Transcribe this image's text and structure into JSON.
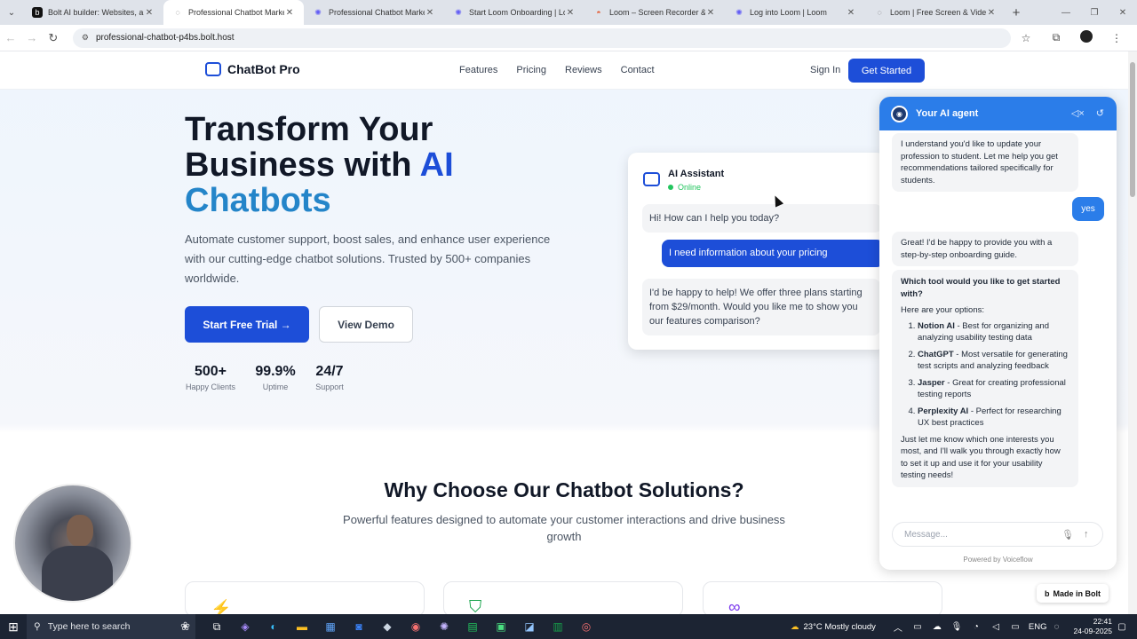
{
  "browser": {
    "tabs": [
      {
        "title": "Bolt AI builder: Websites, apps",
        "icon": "bolt-icon",
        "active": false
      },
      {
        "title": "Professional Chatbot Marketing",
        "icon": "page-icon",
        "active": true
      },
      {
        "title": "Professional Chatbot Marketing",
        "icon": "loom-icon",
        "active": false
      },
      {
        "title": "Start Loom Onboarding | Loom",
        "icon": "loom-icon",
        "active": false
      },
      {
        "title": "Loom – Screen Recorder & Scr",
        "icon": "loom-red-icon",
        "active": false
      },
      {
        "title": "Log into Loom | Loom",
        "icon": "loom-icon",
        "active": false
      },
      {
        "title": "Loom | Free Screen & Video Re",
        "icon": "page-icon",
        "active": false
      }
    ],
    "url": "professional-chatbot-p4bs.bolt.host"
  },
  "site": {
    "logo_text": "ChatBot Pro",
    "nav": [
      "Features",
      "Pricing",
      "Reviews",
      "Contact"
    ],
    "signin": "Sign In",
    "get_started": "Get Started",
    "hero": {
      "line1": "Transform Your",
      "line2a": "Business with ",
      "line2b": "AI",
      "line3": "Chatbots",
      "subtitle": "Automate customer support, boost sales, and enhance user experience with our cutting-edge chatbot solutions. Trusted by 500+ companies worldwide.",
      "primary_btn": "Start Free Trial →",
      "secondary_btn": "View Demo"
    },
    "stats": [
      {
        "value": "500+",
        "label": "Happy Clients"
      },
      {
        "value": "99.9%",
        "label": "Uptime"
      },
      {
        "value": "24/7",
        "label": "Support"
      }
    ],
    "demo": {
      "name": "AI Assistant",
      "status": "Online",
      "msg1": "Hi! How can I help you today?",
      "msg2": "I need information about your pricing",
      "msg3": "I'd be happy to help! We offer three plans starting from $29/month. Would you like me to show you our features comparison?"
    },
    "why_title": "Why Choose Our Chatbot Solutions?",
    "why_sub": "Powerful features designed to automate your customer interactions and drive business growth",
    "made_in_bolt": "Made in Bolt"
  },
  "agent": {
    "title": "Your AI agent",
    "msg1": "I understand you'd like to update your profession to student. Let me help you get recommendations tailored specifically for students.",
    "user_reply": "yes",
    "msg2": "Great! I'd be happy to provide you with a step-by-step onboarding guide.",
    "question": "Which tool would you like to get started with?",
    "options_intro": "Here are your options:",
    "tools": [
      {
        "name": "Notion AI",
        "desc": " - Best for organizing and analyzing usability testing data"
      },
      {
        "name": "ChatGPT",
        "desc": " - Most versatile for generating test scripts and analyzing feedback"
      },
      {
        "name": "Jasper",
        "desc": " - Great for creating professional testing reports"
      },
      {
        "name": "Perplexity AI",
        "desc": " - Perfect for researching UX best practices"
      }
    ],
    "closing": "Just let me know which one interests you most, and I'll walk you through exactly how to set it up and use it for your usability testing needs!",
    "placeholder": "Message...",
    "powered": "Powered by Voiceflow"
  },
  "taskbar": {
    "search": "Type here to search",
    "weather": "23°C  Mostly cloudy",
    "lang": "ENG",
    "time": "22:41",
    "date": "24-09-2025"
  }
}
